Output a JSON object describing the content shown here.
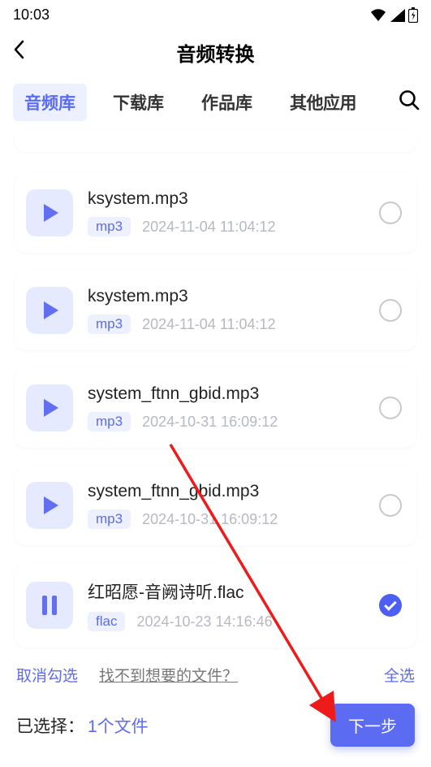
{
  "status": {
    "time": "10:03"
  },
  "header": {
    "title": "音频转换"
  },
  "tabs": [
    "音频库",
    "下载库",
    "作品库",
    "其他应用"
  ],
  "activeTab": 0,
  "files": [
    {
      "name": "ksystem.mp3",
      "ext": "mp3",
      "ts": "2024-11-04 11:04:12",
      "selected": false,
      "playing": false
    },
    {
      "name": "ksystem.mp3",
      "ext": "mp3",
      "ts": "2024-11-04 11:04:12",
      "selected": false,
      "playing": false
    },
    {
      "name": "system_ftnn_gbid.mp3",
      "ext": "mp3",
      "ts": "2024-10-31 16:09:12",
      "selected": false,
      "playing": false
    },
    {
      "name": "system_ftnn_gbid.mp3",
      "ext": "mp3",
      "ts": "2024-10-31 16:09:12",
      "selected": false,
      "playing": false
    },
    {
      "name": "红昭愿-音阙诗听.flac",
      "ext": "flac",
      "ts": "2024-10-23 14:16:46",
      "selected": true,
      "playing": true
    }
  ],
  "links": {
    "cancel": "取消勾选",
    "help": "找不到想要的文件？",
    "all": "全选"
  },
  "footer": {
    "label": "已选择：",
    "count": "1个文件",
    "next": "下一步"
  }
}
